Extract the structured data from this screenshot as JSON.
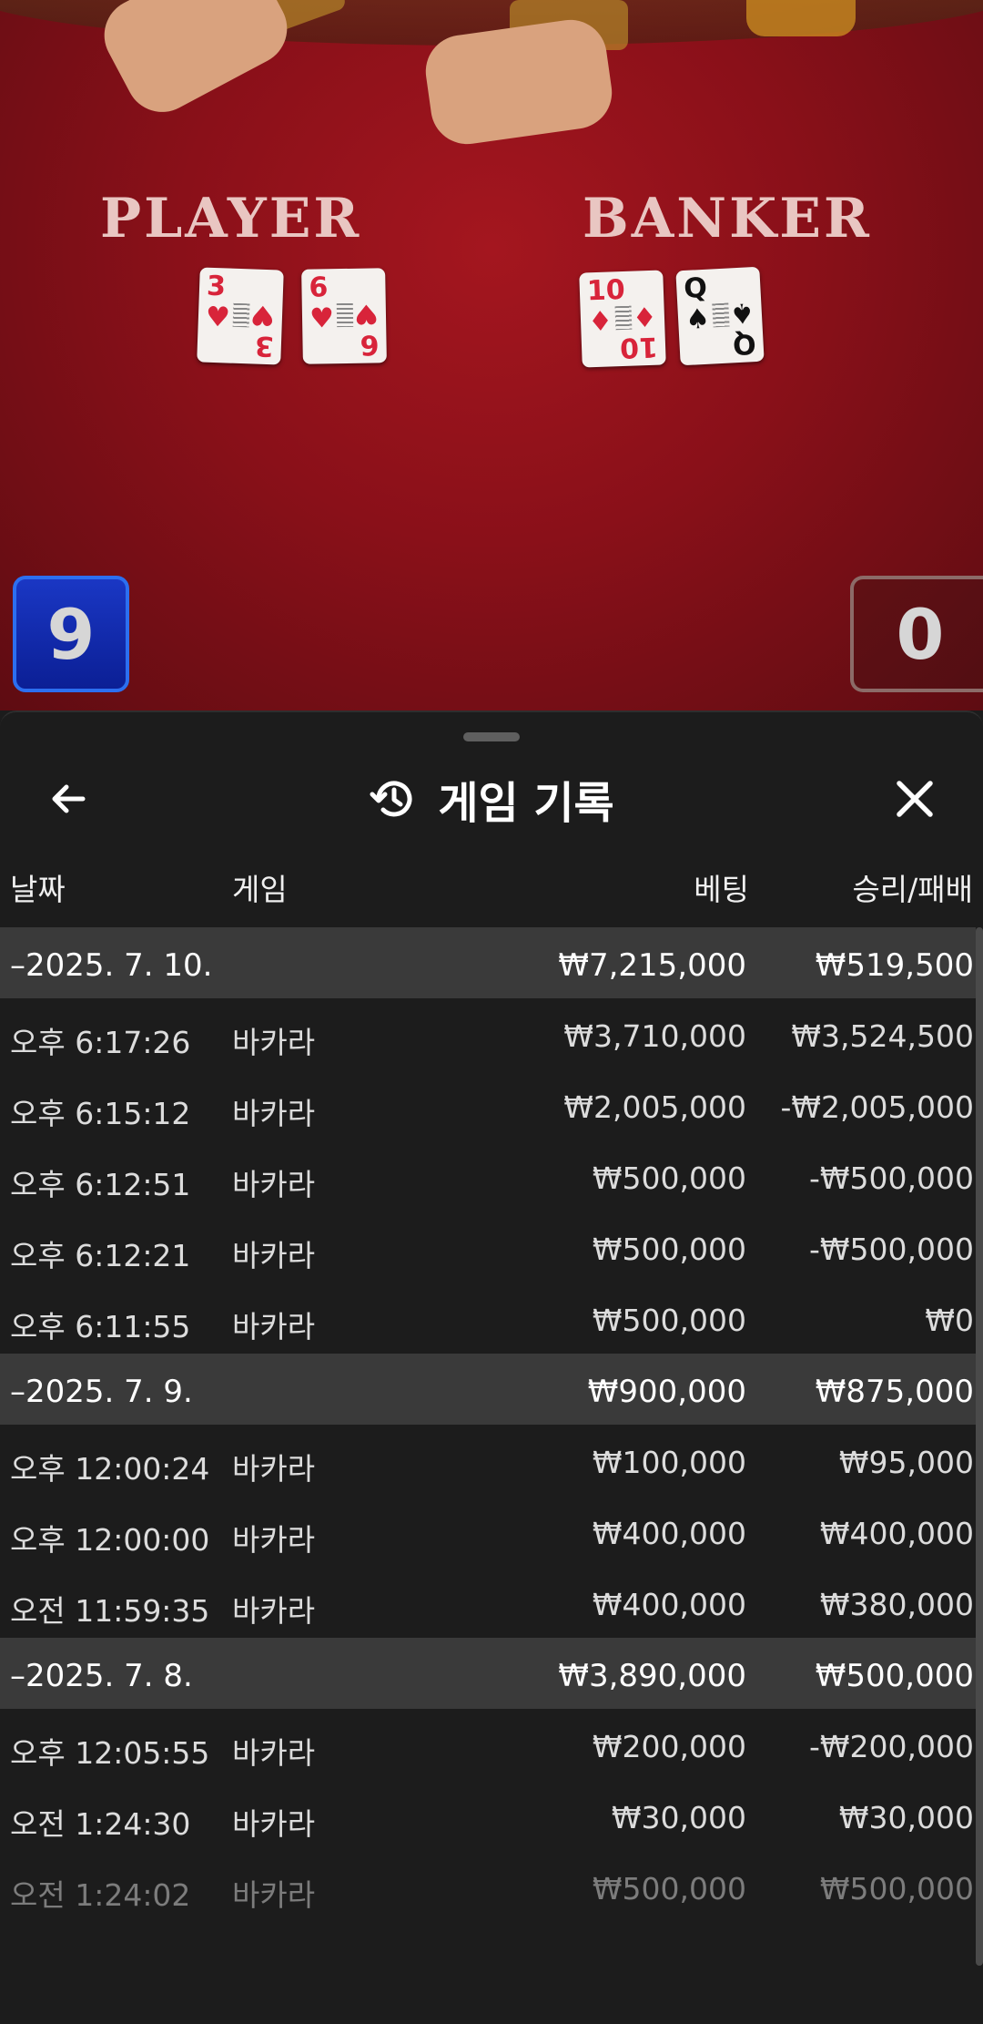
{
  "video": {
    "player_label": "PLAYER",
    "banker_label": "BANKER",
    "player_cards": [
      {
        "rank": "3",
        "suit": "♥",
        "color": "red"
      },
      {
        "rank": "6",
        "suit": "♥",
        "color": "red"
      }
    ],
    "banker_cards": [
      {
        "rank": "10",
        "suit": "♦",
        "color": "red"
      },
      {
        "rank": "Q",
        "suit": "♠",
        "color": "black"
      }
    ],
    "player_score": "9",
    "banker_score": "0"
  },
  "sheet": {
    "title": "게임 기록",
    "icons": {
      "back": "arrow-left-icon",
      "history": "history-icon",
      "close": "close-icon"
    }
  },
  "columns": {
    "date": "날짜",
    "game": "게임",
    "bet": "베팅",
    "win_loss": "승리/패배"
  },
  "groups": [
    {
      "date": "–2025. 7. 10.",
      "bet_total": "₩7,215,000",
      "win_total": "₩519,500",
      "rows": [
        {
          "time": "오후 6:17:26",
          "game": "바카라",
          "bet": "₩3,710,000",
          "win": "₩3,524,500"
        },
        {
          "time": "오후 6:15:12",
          "game": "바카라",
          "bet": "₩2,005,000",
          "win": "-₩2,005,000"
        },
        {
          "time": "오후 6:12:51",
          "game": "바카라",
          "bet": "₩500,000",
          "win": "-₩500,000"
        },
        {
          "time": "오후 6:12:21",
          "game": "바카라",
          "bet": "₩500,000",
          "win": "-₩500,000"
        },
        {
          "time": "오후 6:11:55",
          "game": "바카라",
          "bet": "₩500,000",
          "win": "₩0"
        }
      ]
    },
    {
      "date": "–2025. 7. 9.",
      "bet_total": "₩900,000",
      "win_total": "₩875,000",
      "rows": [
        {
          "time": "오후 12:00:24",
          "game": "바카라",
          "bet": "₩100,000",
          "win": "₩95,000"
        },
        {
          "time": "오후 12:00:00",
          "game": "바카라",
          "bet": "₩400,000",
          "win": "₩400,000"
        },
        {
          "time": "오전 11:59:35",
          "game": "바카라",
          "bet": "₩400,000",
          "win": "₩380,000"
        }
      ]
    },
    {
      "date": "–2025. 7. 8.",
      "bet_total": "₩3,890,000",
      "win_total": "₩500,000",
      "rows": [
        {
          "time": "오후 12:05:55",
          "game": "바카라",
          "bet": "₩200,000",
          "win": "-₩200,000"
        },
        {
          "time": "오전 1:24:30",
          "game": "바카라",
          "bet": "₩30,000",
          "win": "₩30,000"
        },
        {
          "time": "오전 1:24:02",
          "game": "바카라",
          "bet": "₩500,000",
          "win": "₩500,000"
        }
      ]
    }
  ]
}
